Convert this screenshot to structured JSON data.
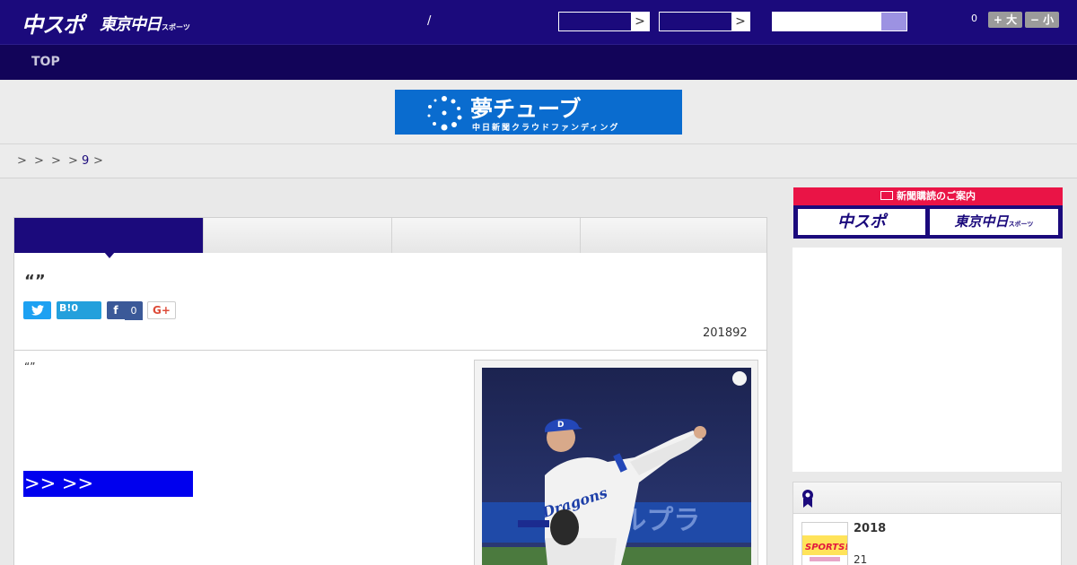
{
  "header": {
    "logo_chuspo": "中スポ",
    "logo_tokyo": "東京中日",
    "logo_tokyo_small": "スポーツ",
    "separator": "/",
    "select1_arrow": ">",
    "select2_arrow": ">",
    "font_count": "0",
    "font_larger": "+ 大",
    "font_smaller": "− 小"
  },
  "nav": {
    "items": [
      {
        "label": "TOP"
      }
    ]
  },
  "banner": {
    "title": "夢チューブ",
    "subtitle": "中日新聞クラウドファンディング"
  },
  "breadcrumb": {
    "items": [
      ">",
      ">",
      ">",
      ">",
      "9",
      ">"
    ]
  },
  "article": {
    "headline": "“”",
    "share": {
      "twitter_icon": "twitter-bird-icon",
      "hatena_label": "B!",
      "hatena_count": "0",
      "facebook_label": "f",
      "facebook_count": "0",
      "gplus_label": "G+"
    },
    "date": "201892",
    "lead": "“”",
    "link_text": ">> >>"
  },
  "sidebar": {
    "subscription_head": "新聞購読のご案内",
    "subscription_btn1": "中スポ",
    "subscription_btn2": "東京中日",
    "subscription_btn2_small": "スポーツ",
    "ranking": {
      "item_title": "2018",
      "item_count": "21",
      "thumb_text": "SPORTS!!"
    }
  },
  "colors": {
    "brand_navy": "#1b0a7c",
    "nav_dark": "#120459",
    "banner_blue": "#0a6ccf",
    "subscription_red": "#ea1446",
    "link_blue": "#0000ee"
  }
}
